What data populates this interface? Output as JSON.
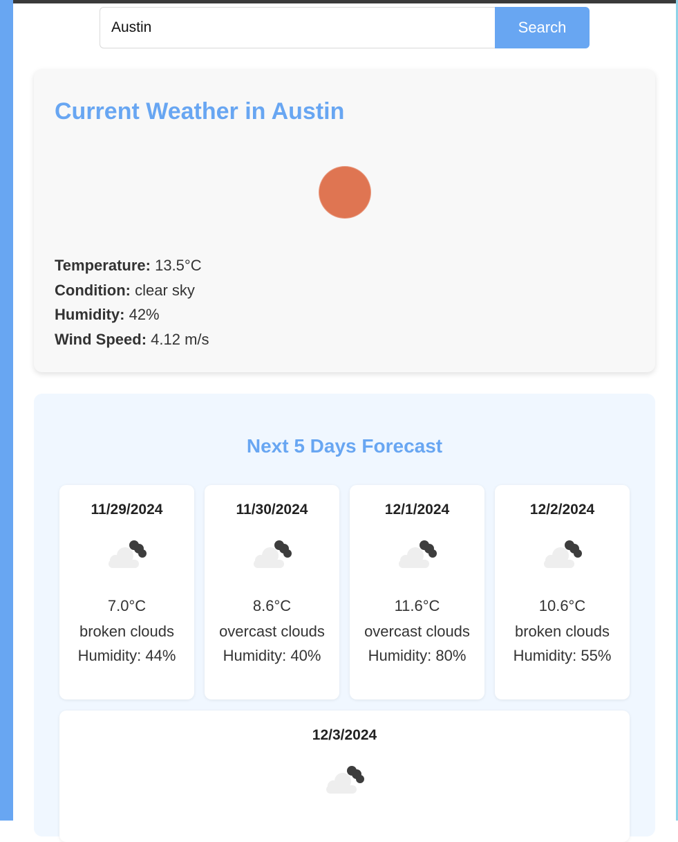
{
  "search": {
    "value": "Austin",
    "button_label": "Search"
  },
  "current": {
    "title": "Current Weather in Austin",
    "icon": "sun-icon",
    "temperature_label": "Temperature:",
    "temperature_value": "13.5°C",
    "condition_label": "Condition:",
    "condition_value": "clear sky",
    "humidity_label": "Humidity:",
    "humidity_value": "42%",
    "wind_label": "Wind Speed:",
    "wind_value": "4.12 m/s"
  },
  "forecast": {
    "title": "Next 5 Days Forecast",
    "days": [
      {
        "date": "11/29/2024",
        "icon": "broken-clouds-icon",
        "temp": "7.0°C",
        "condition": "broken clouds",
        "humidity": "Humidity: 44%"
      },
      {
        "date": "11/30/2024",
        "icon": "overcast-clouds-icon",
        "temp": "8.6°C",
        "condition": "overcast clouds",
        "humidity": "Humidity: 40%"
      },
      {
        "date": "12/1/2024",
        "icon": "overcast-clouds-icon",
        "temp": "11.6°C",
        "condition": "overcast clouds",
        "humidity": "Humidity: 80%"
      },
      {
        "date": "12/2/2024",
        "icon": "broken-clouds-icon",
        "temp": "10.6°C",
        "condition": "broken clouds",
        "humidity": "Humidity: 55%"
      },
      {
        "date": "12/3/2024",
        "icon": "cloud-icon"
      }
    ]
  },
  "colors": {
    "accent": "#68a6f2",
    "sun": "#df7552",
    "forecast_bg": "#f0f7ff",
    "card_bg": "#f8f8f8"
  }
}
